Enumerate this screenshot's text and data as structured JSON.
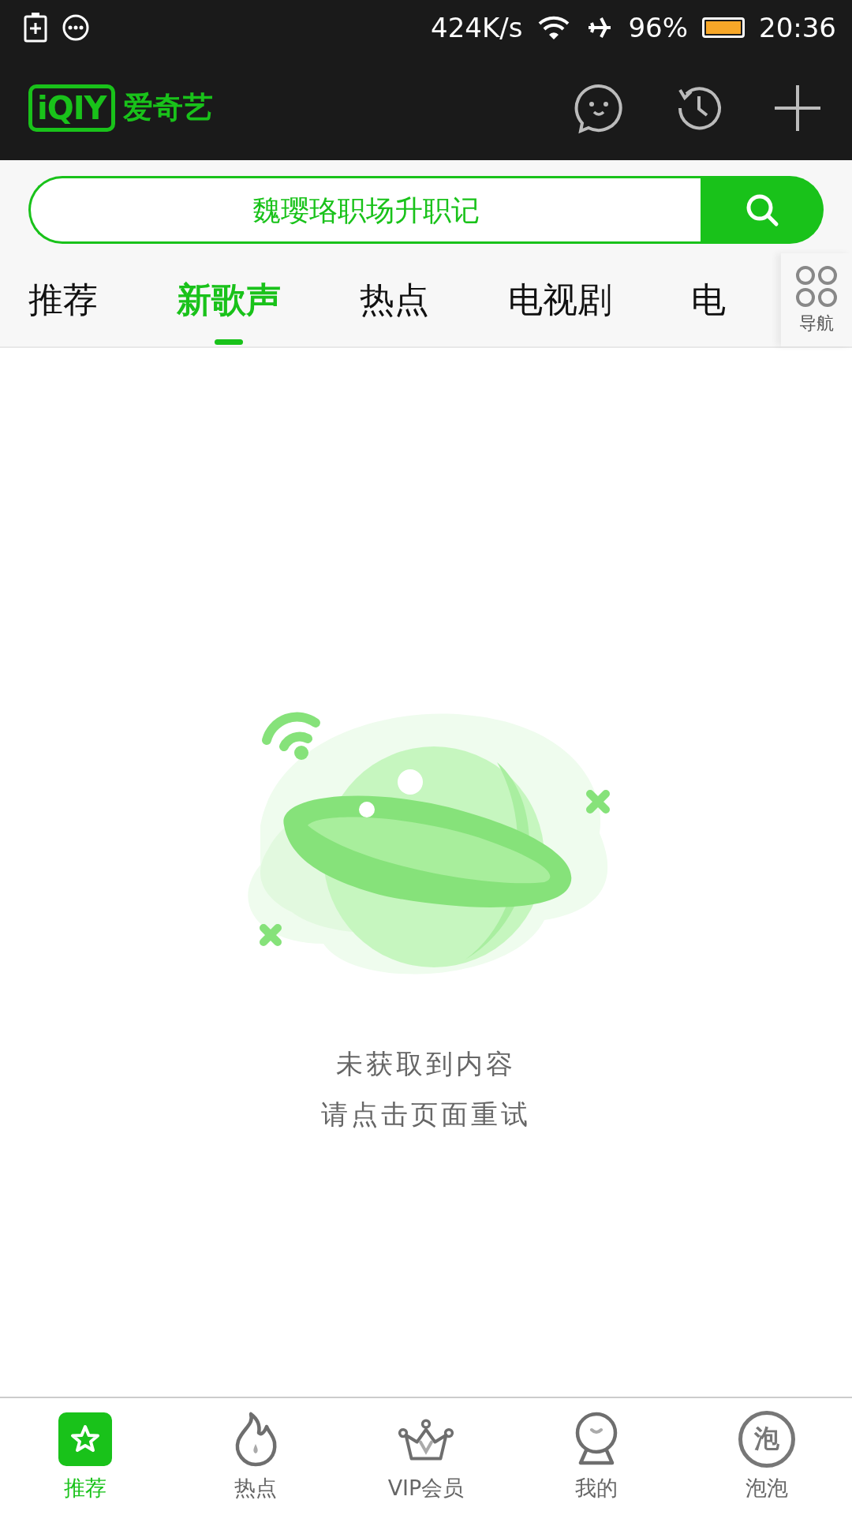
{
  "status_bar": {
    "speed": "424K/s",
    "battery_text": "96%",
    "time": "20:36"
  },
  "header": {
    "logo_text": "iQIY",
    "brand": "爱奇艺"
  },
  "search": {
    "placeholder": "魏璎珞职场升职记"
  },
  "tabs": [
    {
      "label": "推荐",
      "selected": false
    },
    {
      "label": "新歌声",
      "selected": true
    },
    {
      "label": "热点",
      "selected": false
    },
    {
      "label": "电视剧",
      "selected": false
    },
    {
      "label": "电",
      "selected": false
    }
  ],
  "nav_button": {
    "label": "导航"
  },
  "empty_state": {
    "title": "未获取到内容",
    "hint": "请点击页面重试"
  },
  "bottom_nav": [
    {
      "kind": "star",
      "label": "推荐",
      "selected": true
    },
    {
      "kind": "flame",
      "label": "热点",
      "selected": false
    },
    {
      "kind": "crown",
      "label": "VIP会员",
      "selected": false
    },
    {
      "kind": "face",
      "label": "我的",
      "selected": false
    },
    {
      "kind": "bubble",
      "label": "泡泡",
      "selected": false,
      "glyph": "泡"
    }
  ]
}
